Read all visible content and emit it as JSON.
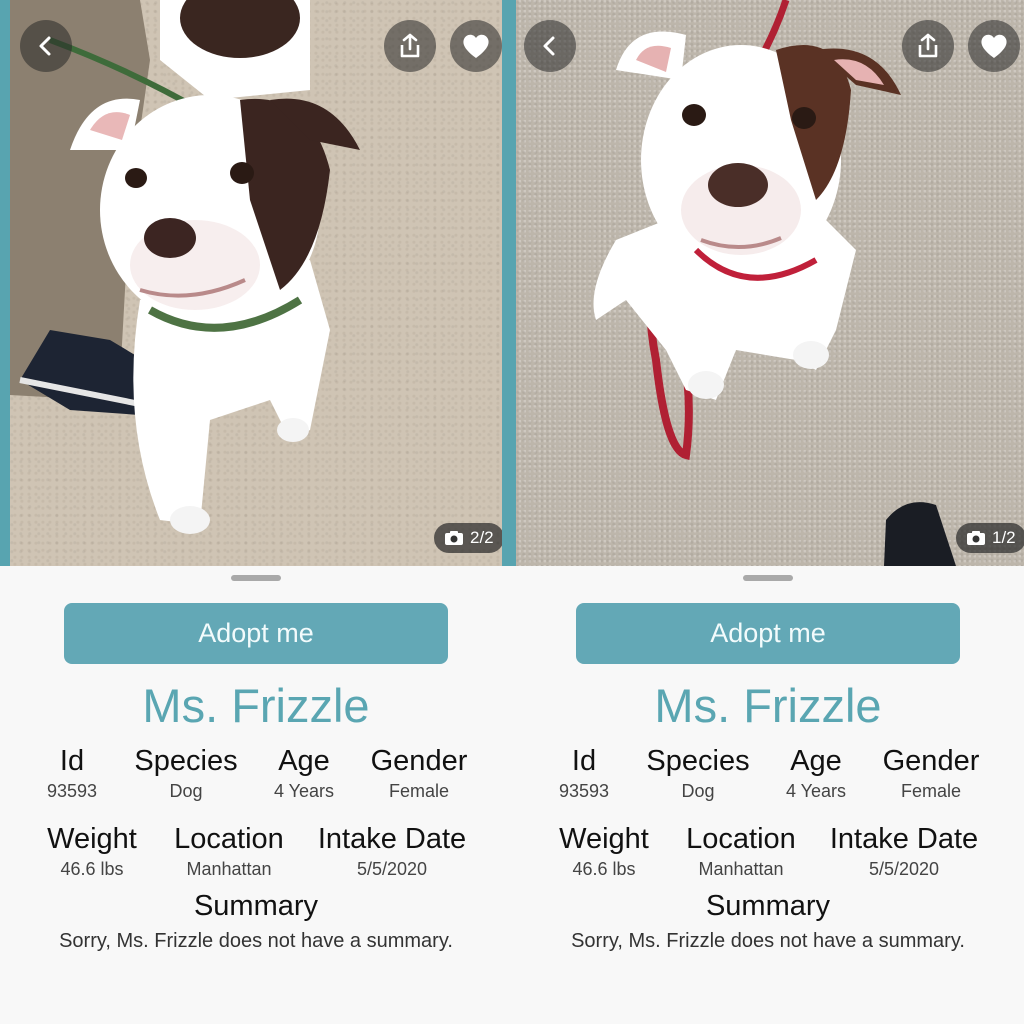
{
  "panels": [
    {
      "photo_counter": "2/2",
      "adopt_label": "Adopt me",
      "pet_name": "Ms. Frizzle",
      "fields": {
        "id": {
          "label": "Id",
          "value": "93593"
        },
        "species": {
          "label": "Species",
          "value": "Dog"
        },
        "age": {
          "label": "Age",
          "value": "4 Years"
        },
        "gender": {
          "label": "Gender",
          "value": "Female"
        },
        "weight": {
          "label": "Weight",
          "value": "46.6 lbs"
        },
        "location": {
          "label": "Location",
          "value": "Manhattan"
        },
        "intake_date": {
          "label": "Intake Date",
          "value": "5/5/2020"
        }
      },
      "summary_title": "Summary",
      "summary_text": "Sorry, Ms. Frizzle does not have a summary."
    },
    {
      "photo_counter": "1/2",
      "adopt_label": "Adopt me",
      "pet_name": "Ms. Frizzle",
      "fields": {
        "id": {
          "label": "Id",
          "value": "93593"
        },
        "species": {
          "label": "Species",
          "value": "Dog"
        },
        "age": {
          "label": "Age",
          "value": "4 Years"
        },
        "gender": {
          "label": "Gender",
          "value": "Female"
        },
        "weight": {
          "label": "Weight",
          "value": "46.6 lbs"
        },
        "location": {
          "label": "Location",
          "value": "Manhattan"
        },
        "intake_date": {
          "label": "Intake Date",
          "value": "5/5/2020"
        }
      },
      "summary_title": "Summary",
      "summary_text": "Sorry, Ms. Frizzle does not have a summary."
    }
  ],
  "icons": {
    "back": "chevron-left-icon",
    "share": "share-icon",
    "favorite": "heart-icon",
    "photo": "camera-icon"
  },
  "colors": {
    "accent": "#63a8b6",
    "name": "#5aa6b2",
    "frame": "#58a4b0"
  }
}
